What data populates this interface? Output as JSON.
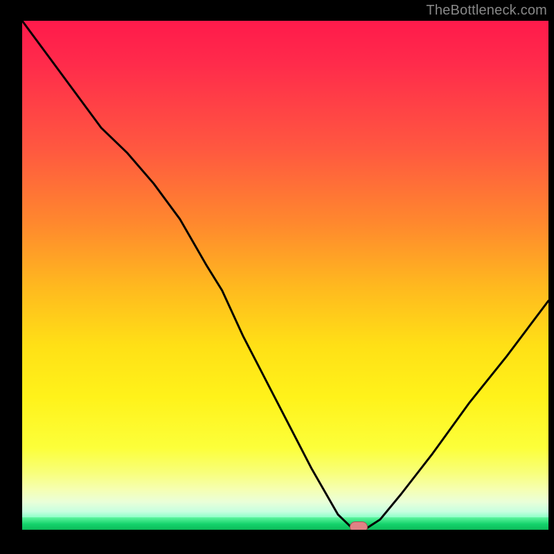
{
  "attribution": "TheBottleneck.com",
  "chart_data": {
    "type": "line",
    "title": "",
    "xlabel": "",
    "ylabel": "",
    "x": [
      0,
      5,
      10,
      15,
      20,
      25,
      30,
      35,
      38,
      42,
      48,
      55,
      60,
      62,
      63,
      65,
      68,
      72,
      78,
      85,
      92,
      100
    ],
    "values": [
      100,
      93,
      86,
      79,
      74,
      68,
      61,
      52,
      47,
      38,
      26,
      12,
      3,
      1,
      0,
      0,
      2,
      7,
      15,
      25,
      34,
      45
    ],
    "xlim": [
      0,
      100
    ],
    "ylim": [
      0,
      100
    ],
    "marker": {
      "x": 64,
      "y": 0.5
    },
    "background_bands": [
      {
        "from_pct": 0,
        "to_pct": 84,
        "start_color": "#ff1a4b",
        "end_color": "#fcff3a"
      },
      {
        "from_pct": 84,
        "to_pct": 92,
        "start_color": "#fcff3a",
        "end_color": "#f6ffb0"
      },
      {
        "from_pct": 92,
        "to_pct": 97.5,
        "start_color": "#f6ffb0",
        "end_color": "#8effc8"
      },
      {
        "from_pct": 97.5,
        "to_pct": 100,
        "start_color": "#5ff5a0",
        "end_color": "#0dbb5a"
      }
    ],
    "line_color": "#000000"
  }
}
